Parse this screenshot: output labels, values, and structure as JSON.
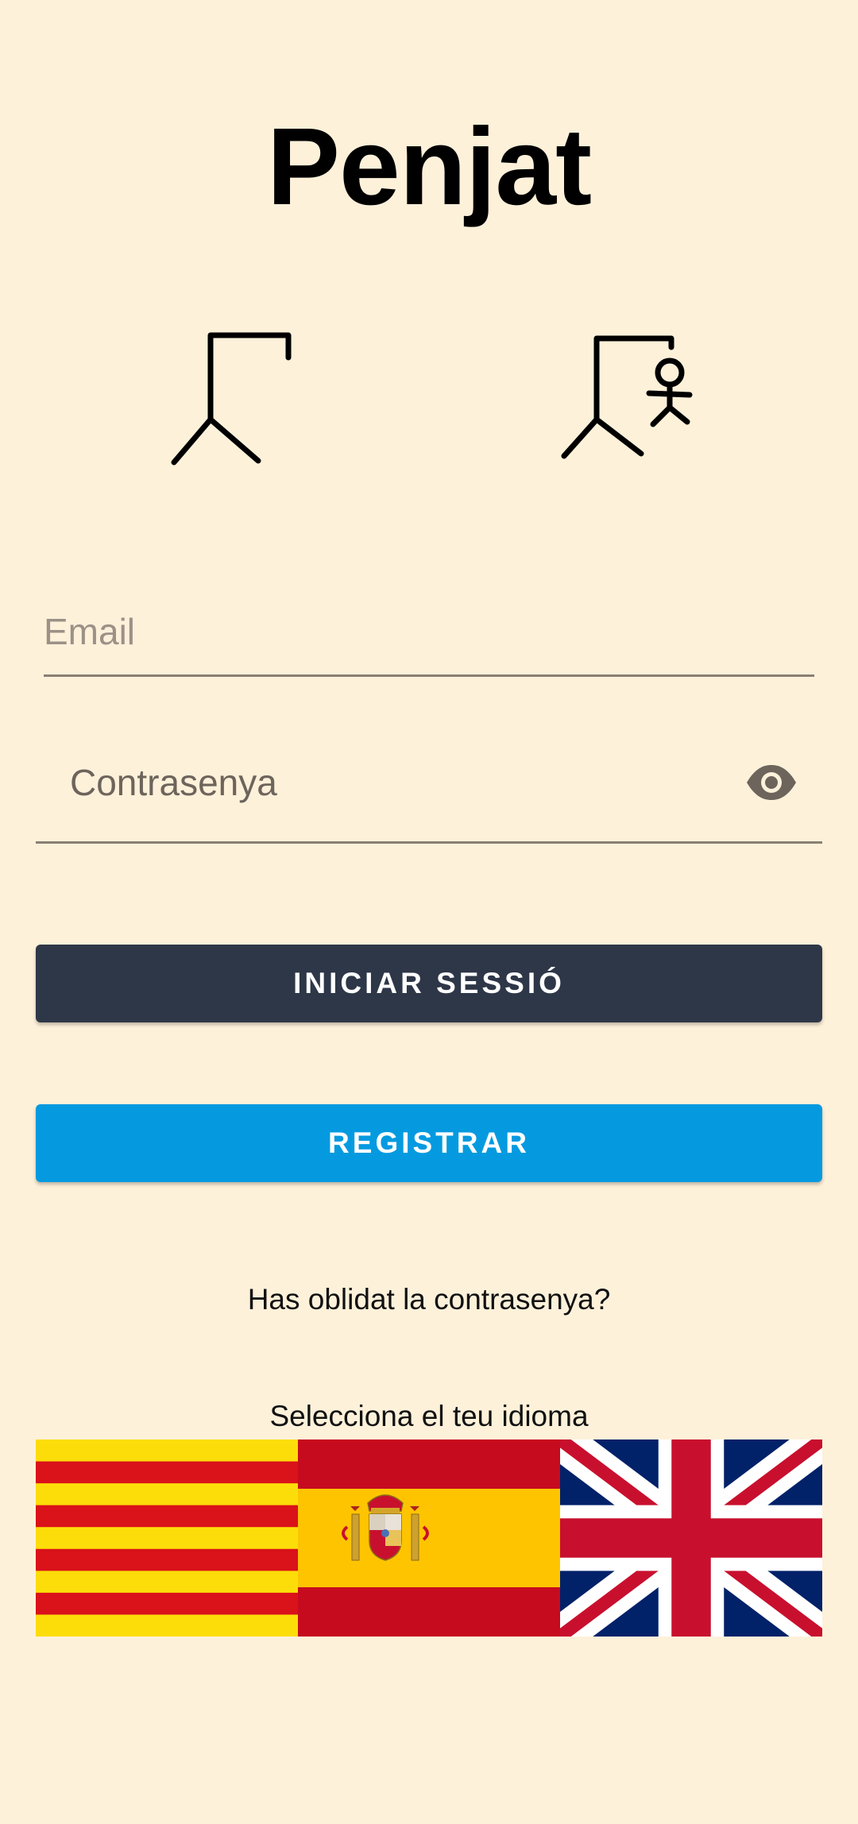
{
  "app": {
    "title": "Penjat"
  },
  "login": {
    "email_placeholder": "Email",
    "password_placeholder": "Contrasenya",
    "password_toggle_icon": "eye-icon",
    "login_button": "INICIAR SESSIÓ",
    "register_button": "REGISTRAR",
    "forgot_password": "Has oblidat la contrasenya?"
  },
  "language": {
    "label": "Selecciona el teu idioma",
    "options": [
      {
        "code": "ca",
        "icon": "catalan-flag-icon"
      },
      {
        "code": "es",
        "icon": "spanish-flag-icon"
      },
      {
        "code": "en",
        "icon": "uk-flag-icon"
      }
    ]
  },
  "colors": {
    "background": "#FEF1DA",
    "login_button": "#2E3748",
    "register_button": "#059AE0",
    "input_underline": "#8A7F72"
  }
}
